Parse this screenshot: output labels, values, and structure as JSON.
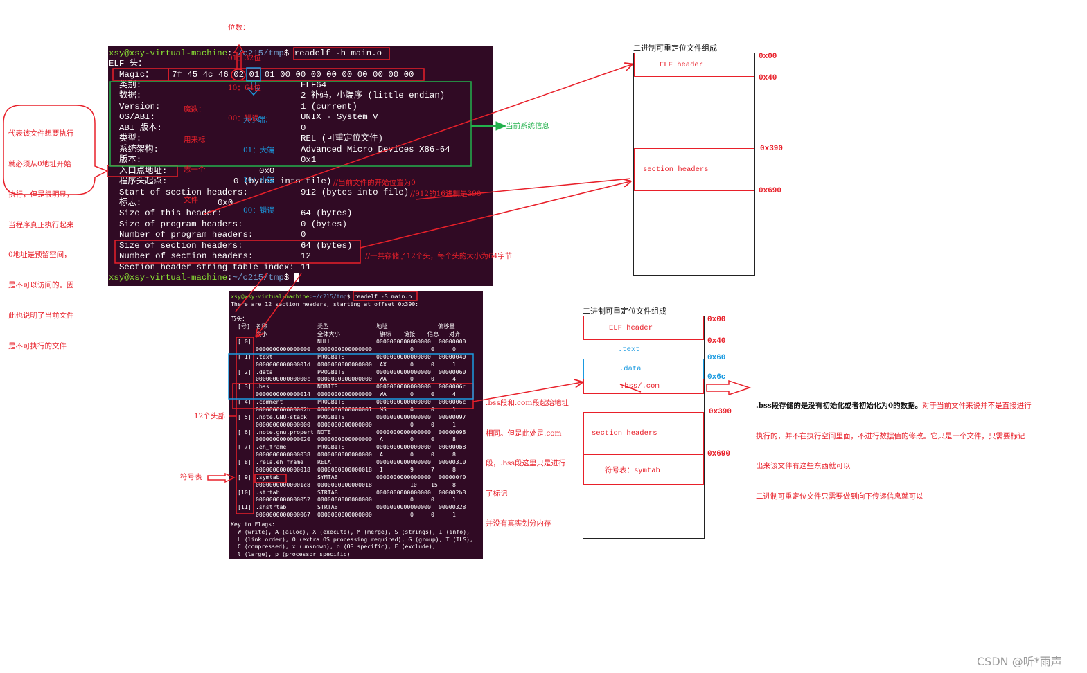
{
  "terminal1": {
    "prompt_user": "xsy@xsy-virtual-machine",
    "prompt_path": "~/c215/tmp",
    "prompt_symbol": "$",
    "command": "readelf -h main.o",
    "heading": "ELF 头：",
    "magic_label": "Magic：",
    "magic_bytes_1": "7f 45 4c 46",
    "magic_class_byte": "02",
    "magic_data_byte": "01",
    "magic_bytes_rest": "01 00 00 00 00 00 00 00 00 00",
    "rows": [
      {
        "label": "类别:",
        "value": "ELF64"
      },
      {
        "label": "数据:",
        "value": "2 补码，小端序 (little endian)"
      },
      {
        "label": "Version:",
        "value": "1 (current)"
      },
      {
        "label": "OS/ABI:",
        "value": "UNIX - System V"
      },
      {
        "label": "ABI 版本:",
        "value": "0"
      },
      {
        "label": "类型:",
        "value": "REL (可重定位文件)"
      },
      {
        "label": "系统架构:",
        "value": "Advanced Micro Devices X86-64"
      },
      {
        "label": "版本:",
        "value": "0x1"
      },
      {
        "label": "入口点地址:",
        "value": "0x0"
      },
      {
        "label": "程序头起点:",
        "value": "0 (bytes into file)"
      },
      {
        "label": "Start of section headers:",
        "value": "912 (bytes into file)"
      },
      {
        "label": "标志:",
        "value": "0x0"
      },
      {
        "label": "Size of this header:",
        "value": "64 (bytes)"
      },
      {
        "label": "Size of program headers:",
        "value": "0 (bytes)"
      },
      {
        "label": "Number of program headers:",
        "value": "0"
      },
      {
        "label": "Size of section headers:",
        "value": "64 (bytes)"
      },
      {
        "label": "Number of section headers:",
        "value": "12"
      },
      {
        "label": "Section header string table index:",
        "value": "11"
      }
    ]
  },
  "terminal2": {
    "prompt_user": "xsy@xsy-virtual-machine",
    "prompt_path": "~/c215/tmp",
    "prompt_symbol": "$",
    "command": "readelf -S main.o",
    "summary": "There are 12 section headers, starting at offset 0x390:",
    "heading": "节头：",
    "columns_1": [
      "[号]",
      "名称",
      "类型",
      "地址",
      "偏移量"
    ],
    "columns_2": [
      "大小",
      "全体大小",
      "旗标",
      "链接",
      "信息",
      "对齐"
    ],
    "sections": [
      {
        "idx": "[ 0]",
        "name": "",
        "type": "NULL",
        "addr": "0000000000000000",
        "offset": "00000000",
        "size": "0000000000000000",
        "entsize": "0000000000000000",
        "flags": "",
        "link": "0",
        "info": "0",
        "align": "0"
      },
      {
        "idx": "[ 1]",
        "name": ".text",
        "type": "PROGBITS",
        "addr": "0000000000000000",
        "offset": "00000040",
        "size": "000000000000001d",
        "entsize": "0000000000000000",
        "flags": "AX",
        "link": "0",
        "info": "0",
        "align": "1"
      },
      {
        "idx": "[ 2]",
        "name": ".data",
        "type": "PROGBITS",
        "addr": "0000000000000000",
        "offset": "00000060",
        "size": "000000000000000c",
        "entsize": "0000000000000000",
        "flags": "WA",
        "link": "0",
        "info": "0",
        "align": "4"
      },
      {
        "idx": "[ 3]",
        "name": ".bss",
        "type": "NOBITS",
        "addr": "0000000000000000",
        "offset": "0000006c",
        "size": "0000000000000014",
        "entsize": "0000000000000000",
        "flags": "WA",
        "link": "0",
        "info": "0",
        "align": "4"
      },
      {
        "idx": "[ 4]",
        "name": ".comment",
        "type": "PROGBITS",
        "addr": "0000000000000000",
        "offset": "0000006c",
        "size": "000000000000002b",
        "entsize": "0000000000000001",
        "flags": "MS",
        "link": "0",
        "info": "0",
        "align": "1"
      },
      {
        "idx": "[ 5]",
        "name": ".note.GNU-stack",
        "type": "PROGBITS",
        "addr": "0000000000000000",
        "offset": "00000097",
        "size": "0000000000000000",
        "entsize": "0000000000000000",
        "flags": "",
        "link": "0",
        "info": "0",
        "align": "1"
      },
      {
        "idx": "[ 6]",
        "name": ".note.gnu.propert",
        "type": "NOTE",
        "addr": "0000000000000000",
        "offset": "00000098",
        "size": "0000000000000020",
        "entsize": "0000000000000000",
        "flags": "A",
        "link": "0",
        "info": "0",
        "align": "8"
      },
      {
        "idx": "[ 7]",
        "name": ".eh_frame",
        "type": "PROGBITS",
        "addr": "0000000000000000",
        "offset": "000000b8",
        "size": "0000000000000038",
        "entsize": "0000000000000000",
        "flags": "A",
        "link": "0",
        "info": "0",
        "align": "8"
      },
      {
        "idx": "[ 8]",
        "name": ".rela.eh_frame",
        "type": "RELA",
        "addr": "0000000000000000",
        "offset": "00000310",
        "size": "0000000000000018",
        "entsize": "0000000000000018",
        "flags": "I",
        "link": "9",
        "info": "7",
        "align": "8"
      },
      {
        "idx": "[ 9]",
        "name": ".symtab",
        "type": "SYMTAB",
        "addr": "0000000000000000",
        "offset": "000000f0",
        "size": "00000000000001c8",
        "entsize": "0000000000000018",
        "flags": "",
        "link": "10",
        "info": "15",
        "align": "8"
      },
      {
        "idx": "[10]",
        "name": ".strtab",
        "type": "STRTAB",
        "addr": "0000000000000000",
        "offset": "000002b8",
        "size": "0000000000000052",
        "entsize": "0000000000000000",
        "flags": "",
        "link": "0",
        "info": "0",
        "align": "1"
      },
      {
        "idx": "[11]",
        "name": ".shstrtab",
        "type": "STRTAB",
        "addr": "0000000000000000",
        "offset": "00000328",
        "size": "0000000000000067",
        "entsize": "0000000000000000",
        "flags": "",
        "link": "0",
        "info": "0",
        "align": "1"
      }
    ],
    "key_to_flags": [
      "Key to Flags:",
      "  W (write), A (alloc), X (execute), M (merge), S (strings), I (info),",
      "  L (link order), O (extra OS processing required), G (group), T (TLS),",
      "  C (compressed), x (unknown), o (OS specific), E (exclude),",
      "  l (large), p (processor specific)"
    ]
  },
  "annotations": {
    "bit_width": [
      "位数：",
      "01：32位",
      "10：64位",
      "00：错误"
    ],
    "magic_note": [
      "魔数：",
      "用来标",
      "志一个",
      "文件"
    ],
    "endian_note": [
      "大小端：",
      "01：大端",
      "10：小端",
      "00：错误"
    ],
    "system_info": "当前系统信息",
    "entry_callout": [
      "代表该文件想要执行",
      "就必须从0地址开始",
      "执行，但是很明显，",
      "当程序真正执行起来",
      "0地址是预留空间，",
      "是不可以访问的。因",
      "此也说明了当前文件",
      "是不可执行的文件"
    ],
    "program_header_comment": "//当前文件的开始位置为0",
    "section_start_comment": "//912的16进制是390",
    "section_count_comment": "//一共存储了12个头，每个头的大小为64字节",
    "twelve_headers": "12个头部",
    "symtab_label": "符号表",
    "bss_note": [
      ".bss段和.com段起始地址",
      "相同。但是此处是.com",
      "段，.bss段这里只是进行",
      "了标记",
      "并没有真实划分内存"
    ],
    "bss_explain_black": ".bss段存储的是没有初始化或者初始化为0的数据。",
    "bss_explain_red": [
      "对于当前文件来说并不是直接进行",
      "执行的，并不在执行空间里面，不进行数据值的修改。它只是一个文件，只需要标记",
      "出来该文件有这些东西就可以",
      "二进制可重定位文件只需要做到向下传递信息就可以"
    ]
  },
  "diagram1": {
    "title": "二进制可重定位文件组成",
    "segments": [
      "ELF header",
      "section headers"
    ],
    "offsets": [
      "0x00",
      "0x40",
      "0x390",
      "0x690"
    ]
  },
  "diagram2": {
    "title": "二进制可重定位文件组成",
    "segments": [
      "ELF header",
      ".text",
      ".data",
      ".bss/.com",
      "section headers",
      "符号表：symtab"
    ],
    "offsets": [
      "0x00",
      "0x40",
      "0x60",
      "0x6c",
      "0x390",
      "0x690"
    ]
  },
  "watermark": "CSDN @听*雨声",
  "colors": {
    "terminal_bg": "#300a24",
    "annotation_red": "#e8202a",
    "annotation_blue": "#1a9ae0",
    "annotation_green": "#22b14c",
    "prompt_green": "#8ae234",
    "prompt_blue": "#729fcf"
  }
}
